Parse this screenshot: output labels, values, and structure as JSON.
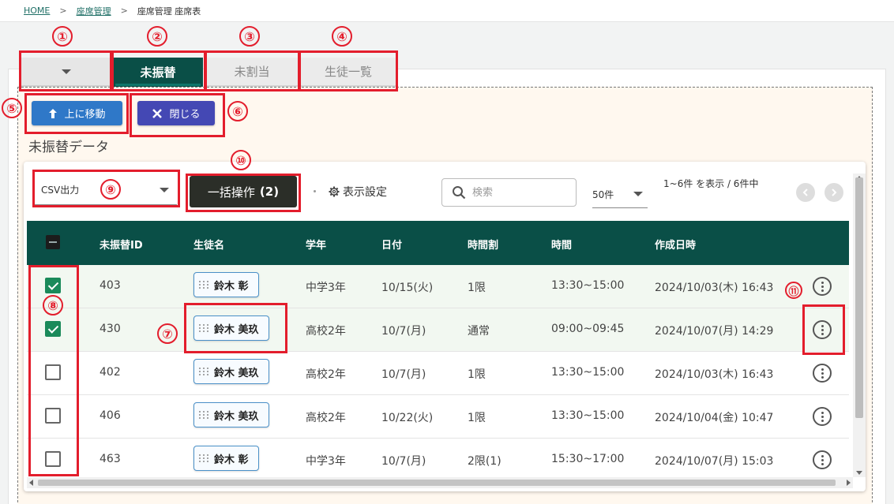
{
  "breadcrumb": {
    "home": "HOME",
    "separator": ">",
    "seat_management": "座席管理",
    "current": "座席管理 座席表"
  },
  "tabs": [
    {
      "label": "",
      "icon": "chevron-down-icon",
      "active": false
    },
    {
      "label": "未振替",
      "active": true
    },
    {
      "label": "未割当",
      "active": false
    },
    {
      "label": "生徒一覧",
      "active": false
    }
  ],
  "actions": {
    "move_up_label": "上に移動",
    "close_label": "閉じる"
  },
  "section_title": "未振替データ",
  "toolbar": {
    "csv_label": "CSV出力",
    "bulk_label": "一括操作",
    "bulk_count": "(2)",
    "display_settings_label": "表示設定",
    "search_placeholder": "検索",
    "per_page": "50件",
    "range_text": "1~6件 を表示 / 6件中"
  },
  "table": {
    "columns": [
      "未振替ID",
      "生徒名",
      "学年",
      "日付",
      "時間割",
      "時間",
      "作成日時"
    ],
    "rows": [
      {
        "checked": true,
        "id": "403",
        "student": "鈴木 彰",
        "grade": "中学3年",
        "date": "10/15(火)",
        "period": "1限",
        "time": "13:30~15:00",
        "created": "2024/10/03(木) 16:43"
      },
      {
        "checked": true,
        "id": "430",
        "student": "鈴木 美玖",
        "grade": "高校2年",
        "date": "10/7(月)",
        "period": "通常",
        "time": "09:00~09:45",
        "created": "2024/10/07(月) 14:29"
      },
      {
        "checked": false,
        "id": "402",
        "student": "鈴木 美玖",
        "grade": "高校2年",
        "date": "10/7(月)",
        "period": "1限",
        "time": "13:30~15:00",
        "created": "2024/10/03(木) 16:43"
      },
      {
        "checked": false,
        "id": "406",
        "student": "鈴木 美玖",
        "grade": "高校2年",
        "date": "10/22(火)",
        "period": "1限",
        "time": "13:30~15:00",
        "created": "2024/10/04(金) 10:47"
      },
      {
        "checked": false,
        "id": "463",
        "student": "鈴木 彰",
        "grade": "中学3年",
        "date": "10/7(月)",
        "period": "2限(1)",
        "time": "15:30~17:00",
        "created": "2024/10/07(月) 15:03"
      }
    ]
  },
  "annotations": [
    "①",
    "②",
    "③",
    "④",
    "⑤",
    "⑥",
    "⑦",
    "⑧",
    "⑨",
    "⑩",
    "⑪"
  ],
  "colors": {
    "brand": "#0a4f47",
    "annotation": "#e31d2c",
    "move_button": "#2f78c8",
    "close_button": "#4448b4",
    "bulk_button": "#2b2e28",
    "checkbox": "#1a8a5a"
  }
}
